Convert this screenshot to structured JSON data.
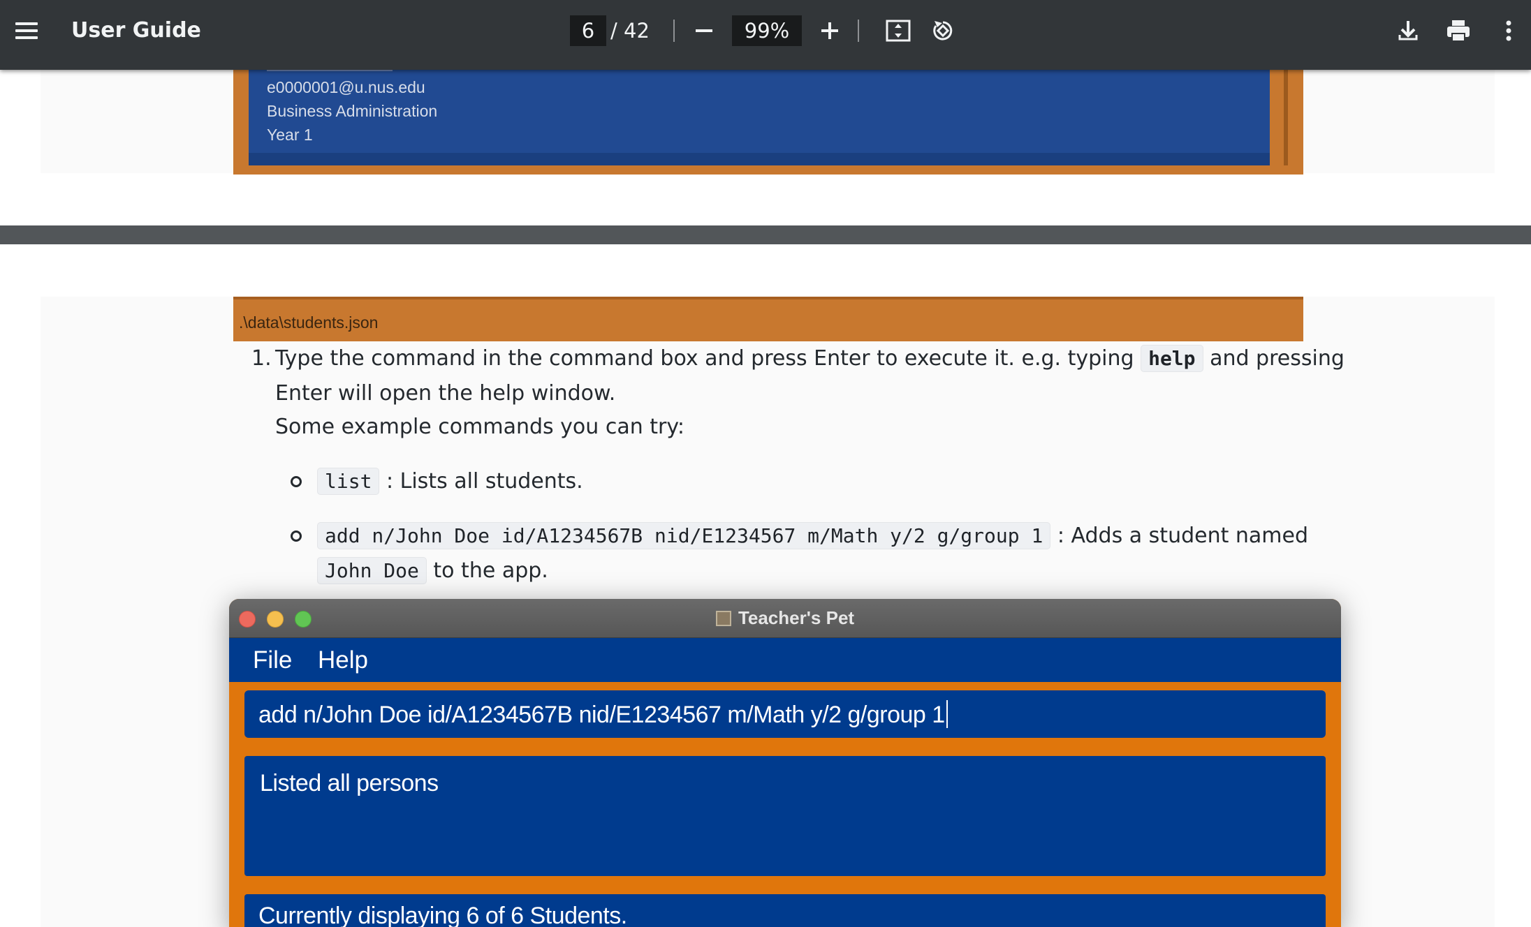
{
  "viewer": {
    "title": "User Guide",
    "current_page": "6",
    "total_pages": "/ 42",
    "zoom": "99%",
    "icons": [
      "menu-icon",
      "zoom-out-icon",
      "zoom-in-icon",
      "fit-page-icon",
      "rotate-icon",
      "download-icon",
      "print-icon",
      "more-vert-icon"
    ]
  },
  "page_top_image": {
    "lines": [
      "e0000001@u.nus.edu",
      "Business Administration",
      "Year 1"
    ]
  },
  "doc": {
    "file_path": ".\\data\\students.json",
    "step_number": "1.",
    "step_text_a": "Type the command in the command box and press Enter to execute it. e.g. typing",
    "code_help": "help",
    "step_text_b": "and pressing",
    "step_text_c": "Enter will open the help window.",
    "step_text_d": "Some example commands you can try:",
    "bullets": [
      {
        "code": "list",
        "text": ": Lists all students."
      },
      {
        "code": "add n/John Doe id/A1234567B nid/E1234567 m/Math y/2 g/group 1",
        "text": ": Adds a student named",
        "code2": "John Doe",
        "text2": "to the app."
      }
    ]
  },
  "app": {
    "window_title": "Teacher's Pet",
    "menu": [
      "File",
      "Help"
    ],
    "command_value": "add n/John Doe id/A1234567B nid/E1234567 m/Math y/2 g/group 1",
    "result_text": "Listed all persons",
    "status_text": "Currently displaying 6 of 6 Students.",
    "colors": {
      "primary": "#003b8e",
      "accent": "#e0760c"
    }
  }
}
